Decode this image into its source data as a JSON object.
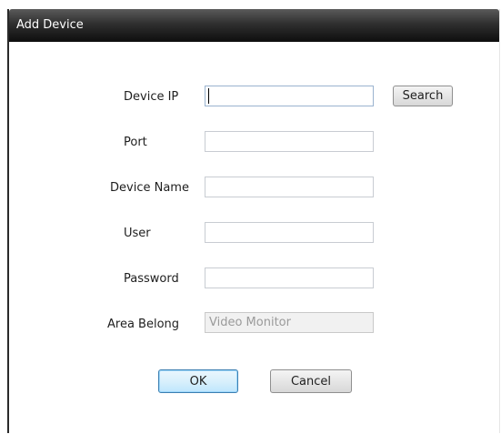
{
  "window": {
    "title": "Add Device"
  },
  "form": {
    "device_ip": {
      "label": "Device IP",
      "value": ""
    },
    "port": {
      "label": "Port",
      "value": ""
    },
    "device_name": {
      "label": "Device Name",
      "value": ""
    },
    "user": {
      "label": "User",
      "value": ""
    },
    "password": {
      "label": "Password",
      "value": ""
    },
    "area_belong": {
      "label": "Area Belong",
      "value": "Video Monitor",
      "disabled": true
    }
  },
  "buttons": {
    "search": "Search",
    "ok": "OK",
    "cancel": "Cancel"
  },
  "colors": {
    "title_bar": "#1a1a1a",
    "default_button": "#bee6fd",
    "field_border": "#c8ccd2"
  }
}
